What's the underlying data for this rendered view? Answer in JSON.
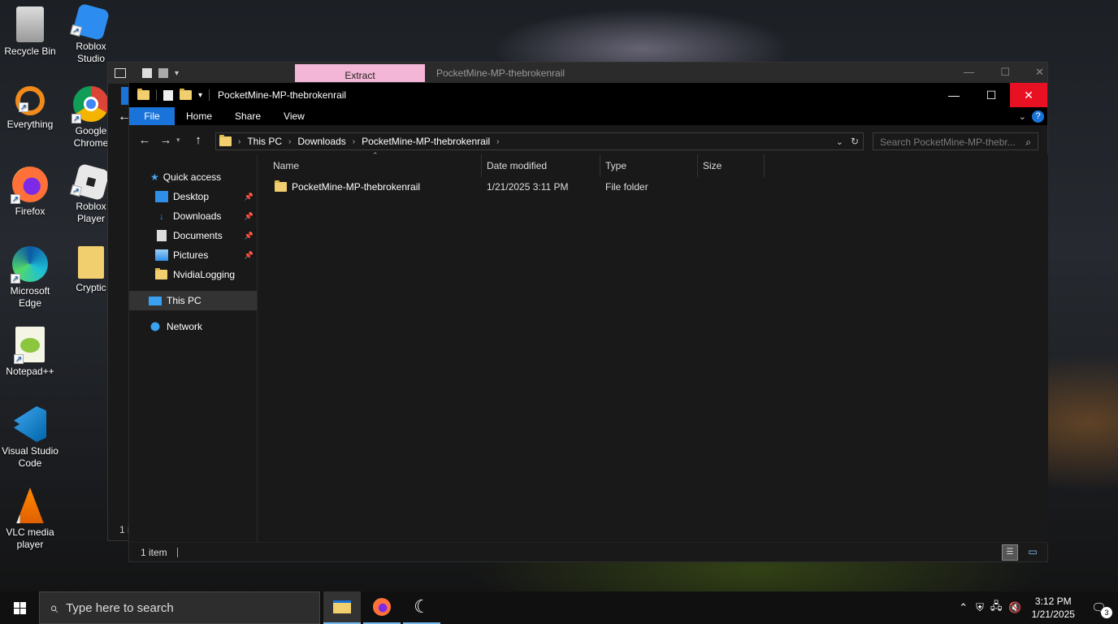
{
  "desktop": {
    "icons": [
      {
        "label": "Recycle Bin"
      },
      {
        "label": "Roblox Studio"
      },
      {
        "label": "Everything"
      },
      {
        "label": "Google Chrome"
      },
      {
        "label": "Firefox"
      },
      {
        "label": "Roblox Player"
      },
      {
        "label": "Microsoft Edge"
      },
      {
        "label": "Cryptic"
      },
      {
        "label": "Notepad++"
      },
      {
        "label": "Visual Studio Code"
      },
      {
        "label": "VLC media player"
      }
    ]
  },
  "back_window": {
    "extract_tab": "Extract",
    "title": "PocketMine-MP-thebrokenrail",
    "status": "1 i"
  },
  "window": {
    "title": "PocketMine-MP-thebrokenrail"
  },
  "ribbon": {
    "tabs": [
      "File",
      "Home",
      "Share",
      "View"
    ]
  },
  "breadcrumb": [
    "This PC",
    "Downloads",
    "PocketMine-MP-thebrokenrail"
  ],
  "search": {
    "placeholder": "Search PocketMine-MP-thebr..."
  },
  "nav": {
    "quick_access": "Quick access",
    "pinned": [
      {
        "label": "Desktop"
      },
      {
        "label": "Downloads"
      },
      {
        "label": "Documents"
      },
      {
        "label": "Pictures"
      },
      {
        "label": "NvidiaLogging"
      }
    ],
    "this_pc": "This PC",
    "network": "Network"
  },
  "columns": {
    "name": "Name",
    "date": "Date modified",
    "type": "Type",
    "size": "Size"
  },
  "files": [
    {
      "name": "PocketMine-MP-thebrokenrail",
      "date": "1/21/2025 3:11 PM",
      "type": "File folder",
      "size": ""
    }
  ],
  "status": {
    "count": "1 item"
  },
  "taskbar": {
    "search_placeholder": "Type here to search",
    "time": "3:12 PM",
    "date": "1/21/2025",
    "notifications": "3"
  },
  "colors": {
    "accent": "#1a73d9",
    "close_hover": "#e81123",
    "extract": "#f4b6d6"
  }
}
